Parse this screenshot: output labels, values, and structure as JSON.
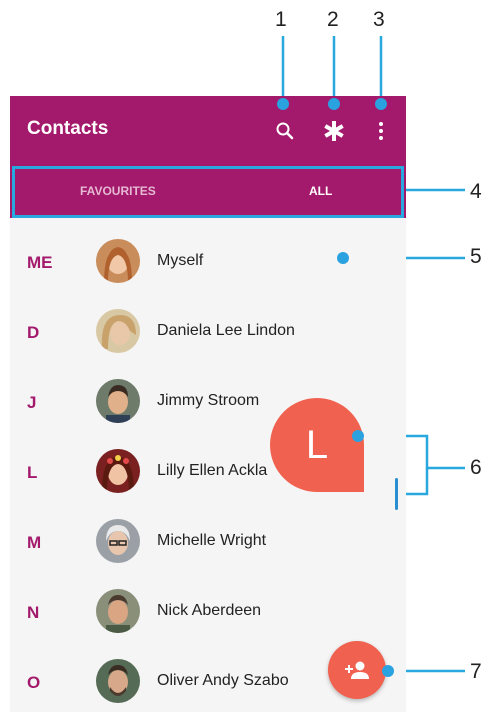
{
  "app": {
    "title": "Contacts",
    "bar_color": "#a3196b",
    "accent_color": "#f0614f",
    "callout_color": "#29a8e0"
  },
  "toolbar": {
    "search_icon": "search-icon",
    "favorites_icon": "asterisk-icon",
    "more_icon": "more-vert-icon"
  },
  "tabs": [
    {
      "label": "FAVOURITES",
      "active": false
    },
    {
      "label": "ALL",
      "active": true
    }
  ],
  "contacts": [
    {
      "letter": "ME",
      "name": "Myself"
    },
    {
      "letter": "D",
      "name": "Daniela Lee Lindon"
    },
    {
      "letter": "J",
      "name": "Jimmy Stroom"
    },
    {
      "letter": "L",
      "name": "Lilly Ellen Ackla"
    },
    {
      "letter": "M",
      "name": "Michelle Wright"
    },
    {
      "letter": "N",
      "name": "Nick Aberdeen"
    },
    {
      "letter": "O",
      "name": "Oliver Andy Szabo"
    }
  ],
  "scroll_bubble": {
    "letter": "L"
  },
  "fab": {
    "icon": "add-contact-icon"
  },
  "callouts": [
    "1",
    "2",
    "3",
    "4",
    "5",
    "6",
    "7"
  ]
}
